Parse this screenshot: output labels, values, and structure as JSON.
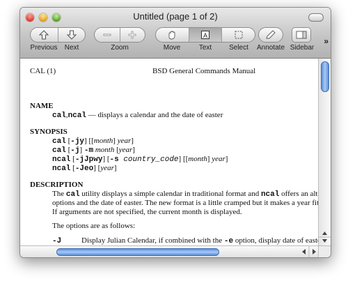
{
  "window": {
    "title": "Untitled (page 1 of 2)"
  },
  "toolbar": {
    "previous": "Previous",
    "next": "Next",
    "zoom": "Zoom",
    "move": "Move",
    "text": "Text",
    "select": "Select",
    "annotate": "Annotate",
    "sidebar": "Sidebar",
    "overflow": "»"
  },
  "doc": {
    "header_left": "CAL (1)",
    "header_center": "BSD General Commands Manual",
    "name_heading": "NAME",
    "name_cmd1": "cal",
    "name_sep": ",",
    "name_cmd2": "ncal",
    "name_desc": " — displays a calendar and the date of easter",
    "synopsis_heading": "SYNOPSIS",
    "syn1_cmd": "cal",
    "syn1_a": " [",
    "syn1_flags": "-jy",
    "syn1_b": "] [[",
    "syn1_month": "month",
    "syn1_c": "] ",
    "syn1_year": "year",
    "syn1_d": "]",
    "syn2_cmd": "cal",
    "syn2_a": " [",
    "syn2_flags": "-j",
    "syn2_b": "] ",
    "syn2_m": "-m",
    "syn2_month": " month",
    "syn2_c": " [",
    "syn2_year": "year",
    "syn2_d": "]",
    "syn3_cmd": "ncal",
    "syn3_a": " [",
    "syn3_flags": "-jJpwy",
    "syn3_b": "] [",
    "syn3_s": "-s",
    "syn3_cc": " country_code",
    "syn3_c": "] [[",
    "syn3_month": "month",
    "syn3_d": "] ",
    "syn3_year": "year",
    "syn3_e": "]",
    "syn4_cmd": "ncal",
    "syn4_a": " [",
    "syn4_flags": "-Jeo",
    "syn4_b": "] [",
    "syn4_year": "year",
    "syn4_c": "]",
    "description_heading": "DESCRIPTION",
    "desc1_a": "The ",
    "desc1_cal": "cal",
    "desc1_b": " utility displays a simple calendar in traditional format and ",
    "desc1_ncal": "ncal",
    "desc1_c": " offers an altern",
    "desc2": "options and the date of easter.  The new format is a little cramped but it makes a year fit on",
    "desc3": "If arguments are not specified, the current month is displayed.",
    "options_intro": "The options are as follows:",
    "opt_flag": "-J",
    "opt_text_a": "Display Julian Calendar, if combined with the ",
    "opt_e": "-e",
    "opt_text_b": " option, display date of easte"
  },
  "colors": {
    "scroll_thumb": "#6a9be0",
    "titlebar": "#c6c6c6"
  }
}
